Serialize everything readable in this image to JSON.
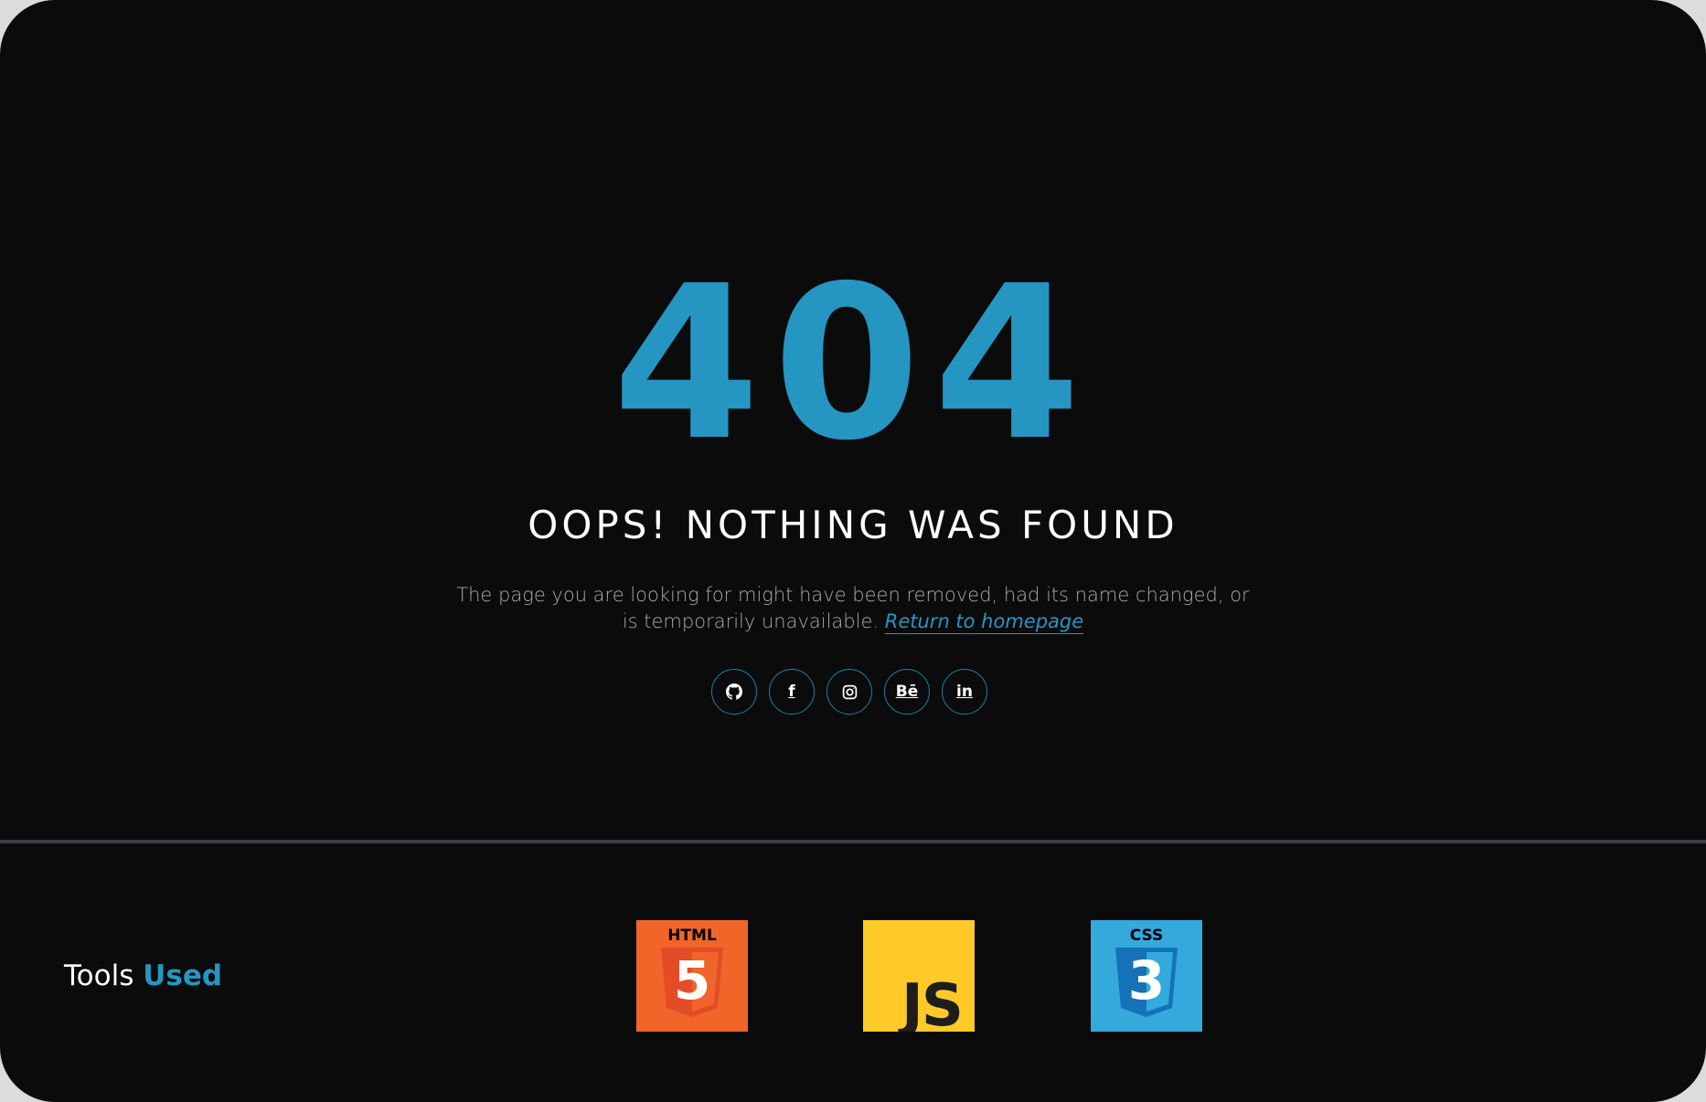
{
  "hero": {
    "code": "404",
    "headline": "OOPS! NOTHING WAS FOUND",
    "description": "The page you are looking for might have been removed, had its name changed, or is temporarily unavailable.",
    "link_text": "Return to homepage"
  },
  "socials": [
    {
      "name": "github",
      "icon": "github-icon"
    },
    {
      "name": "facebook",
      "icon": "facebook-icon",
      "glyph": "f"
    },
    {
      "name": "instagram",
      "icon": "instagram-icon"
    },
    {
      "name": "behance",
      "icon": "behance-icon",
      "glyph": "Bē"
    },
    {
      "name": "linkedin",
      "icon": "linkedin-icon",
      "glyph": "in"
    }
  ],
  "tools": {
    "title_plain": "Tools",
    "title_accent": "Used",
    "logos": [
      {
        "name": "html5",
        "label": "HTML",
        "digit": "5",
        "color": "#f16529"
      },
      {
        "name": "javascript",
        "label": "JS",
        "color": "#ffca28"
      },
      {
        "name": "css3",
        "label": "CSS",
        "digit": "3",
        "color": "#33a9dc"
      }
    ]
  },
  "colors": {
    "background": "#0b0b0c",
    "accent": "#2596c2",
    "text": "#ffffff",
    "muted_text": "#a9a9a9",
    "divider": "#3a3b45"
  }
}
